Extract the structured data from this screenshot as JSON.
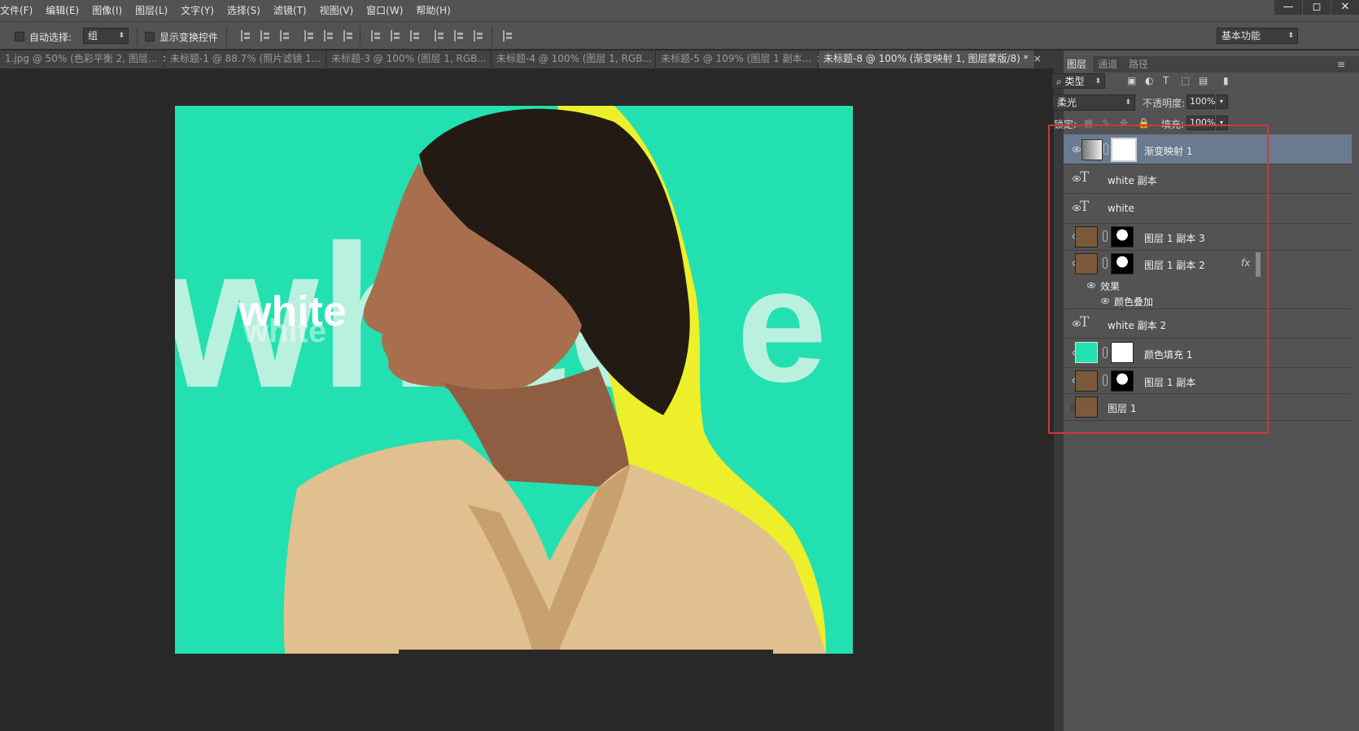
{
  "menubar": {
    "items": [
      "文件(F)",
      "编辑(E)",
      "图像(I)",
      "图层(L)",
      "文字(Y)",
      "选择(S)",
      "滤镜(T)",
      "视图(V)",
      "窗口(W)",
      "帮助(H)"
    ],
    "window_controls": {
      "minimize": "—",
      "restore": "◻",
      "close": "✕"
    }
  },
  "options": {
    "auto_select_label": "自动选择:",
    "auto_select_value": "组",
    "show_transform_label": "显示变换控件",
    "workspace_value": "基本功能"
  },
  "tabs": [
    {
      "label": "1.jpg @ 50% (色彩平衡 2, 图层..."
    },
    {
      "label": "未标题-1 @ 88.7% (照片滤镜 1..."
    },
    {
      "label": "未标题-3 @ 100% (图层 1, RGB..."
    },
    {
      "label": "未标题-4 @ 100% (图层 1, RGB..."
    },
    {
      "label": "未标题-5 @ 109% (图层 1 副本..."
    },
    {
      "label": "未标题-8 @ 100% (渐变映射 1, 图层蒙版/8) *"
    }
  ],
  "tab_close": "×",
  "canvas": {
    "big_text": "white",
    "small_text": "white",
    "bg_color": "#23e0b0",
    "accent_color": "#ecef2a"
  },
  "panel": {
    "tabs": [
      "图层",
      "通道",
      "路径"
    ],
    "filter_label": "类型",
    "blend_mode": "柔光",
    "opacity_label": "不透明度:",
    "opacity_value": "100%",
    "lock_label": "锁定:",
    "fill_label": "填充:",
    "fill_value": "100%"
  },
  "layers": [
    {
      "name": "渐变映射 1",
      "kind": "adjustment",
      "visible": true,
      "selected": true
    },
    {
      "name": "white 副本",
      "kind": "text",
      "visible": true
    },
    {
      "name": "white",
      "kind": "text",
      "visible": true
    },
    {
      "name": "图层 1 副本 3",
      "kind": "masked-image",
      "visible": true
    },
    {
      "name": "图层 1 副本 2",
      "kind": "masked-image",
      "visible": true,
      "fx": "fx"
    },
    {
      "name": "效果",
      "kind": "effect-group"
    },
    {
      "name": "颜色叠加",
      "kind": "effect"
    },
    {
      "name": "white 副本 2",
      "kind": "text",
      "visible": true
    },
    {
      "name": "颜色填充 1",
      "kind": "fill",
      "visible": true
    },
    {
      "name": "图层 1 副本",
      "kind": "masked-image",
      "visible": true
    },
    {
      "name": "图层 1",
      "kind": "image",
      "visible": false
    }
  ],
  "text_layer_glyph": "T"
}
